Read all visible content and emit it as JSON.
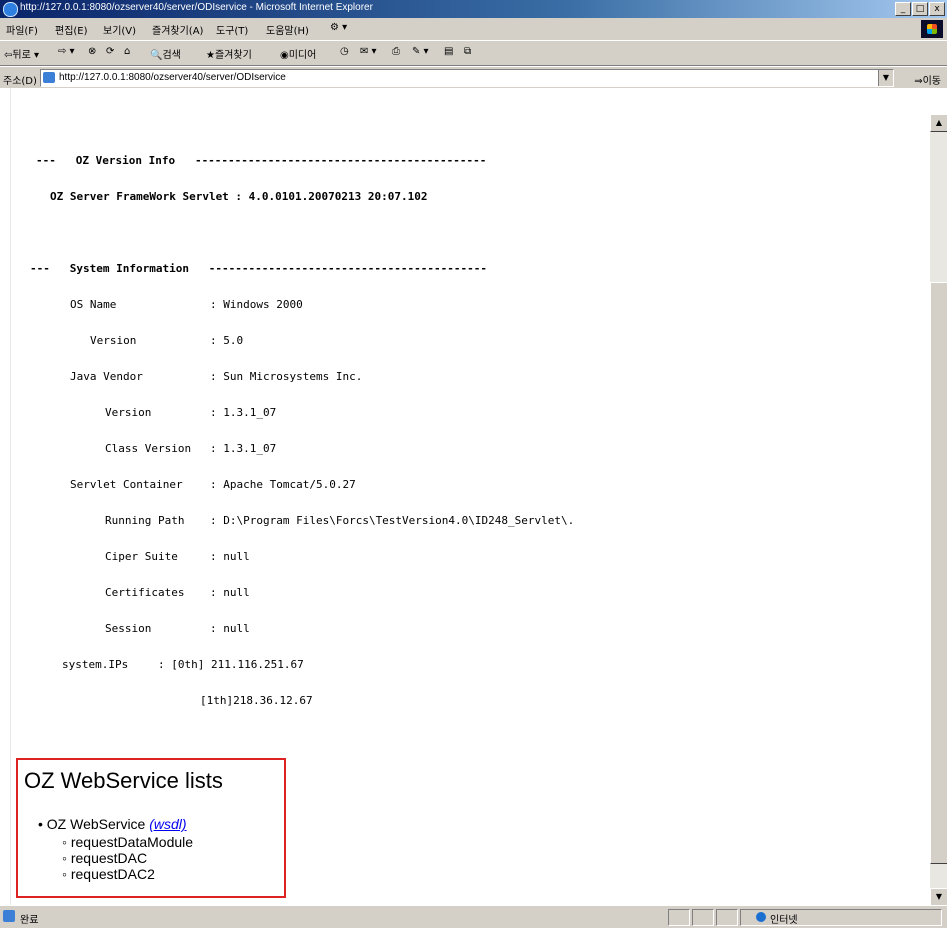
{
  "window": {
    "title": "http://127.0.0.1:8080/ozserver40/server/ODIservice - Microsoft Internet Explorer",
    "controls": [
      "_",
      "□",
      "x"
    ]
  },
  "menu": [
    "파일(F)",
    "편집(E)",
    "보기(V)",
    "즐겨찾기(A)",
    "도구(T)",
    "도움말(H)"
  ],
  "toolbar": {
    "back": "뒤로",
    "search": "검색",
    "favorites": "즐겨찾기",
    "media": "미디어"
  },
  "address": {
    "label": "주소(D)",
    "url": "http://127.0.0.1:8080/ozserver40/server/ODIservice",
    "go": "이동"
  },
  "version_info": {
    "header": "---   OZ Version Info   --------------------------------------------",
    "line": "OZ Server FrameWork Servlet : 4.0.0101.20070213 20:07.102"
  },
  "system_info": {
    "header": "---   System Information   ------------------------------------------",
    "rows": [
      {
        "label": "OS Name",
        "value": ": Windows 2000"
      },
      {
        "label": "Version",
        "value": ": 5.0"
      },
      {
        "label": "Java Vendor",
        "value": ": Sun Microsystems Inc."
      },
      {
        "label": "Version",
        "value": ": 1.3.1_07"
      },
      {
        "label": "Class Version",
        "value": ": 1.3.1_07"
      },
      {
        "label": "Servlet Container",
        "value": ": Apache Tomcat/5.0.27"
      },
      {
        "label": "Running Path",
        "value": ": D:\\Program Files\\Forcs\\TestVersion4.0\\ID248_Servlet\\."
      },
      {
        "label": "Ciper Suite",
        "value": ": null"
      },
      {
        "label": "Certificates",
        "value": ": null"
      },
      {
        "label": "Session",
        "value": ": null"
      }
    ],
    "ips_label": "system.IPs",
    "ips": [
      ": [0th] 211.116.251.67",
      "[1th]218.36.12.67"
    ]
  },
  "webservice": {
    "title": "OZ WebService lists",
    "service": "OZ WebService",
    "wsdl": "(wsdl)",
    "methods": [
      "requestDataModule",
      "requestDAC",
      "requestDAC2"
    ]
  },
  "status": {
    "text": "완료",
    "zone": "인터넷"
  }
}
